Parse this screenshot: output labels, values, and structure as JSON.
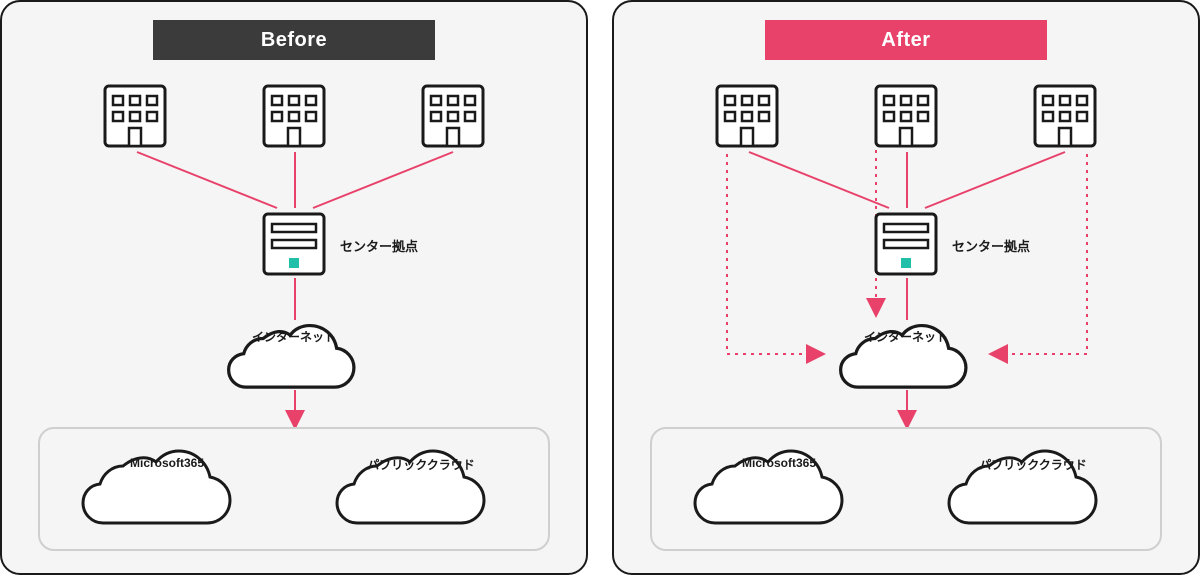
{
  "before": {
    "header": "Before",
    "server_label": "センター拠点",
    "internet_label": "インターネット",
    "clouds": {
      "left": "Microsoft365",
      "right": "パブリッククラウド"
    }
  },
  "after": {
    "header": "After",
    "server_label": "センター拠点",
    "internet_label": "インターネット",
    "clouds": {
      "left": "Microsoft365",
      "right": "パブリッククラウド"
    }
  },
  "colors": {
    "accent": "#e8426b",
    "dark": "#3b3b3b",
    "outline": "#1a1a1a",
    "tray": "#cfcfcf",
    "server_dot": "#1fbfa8"
  }
}
